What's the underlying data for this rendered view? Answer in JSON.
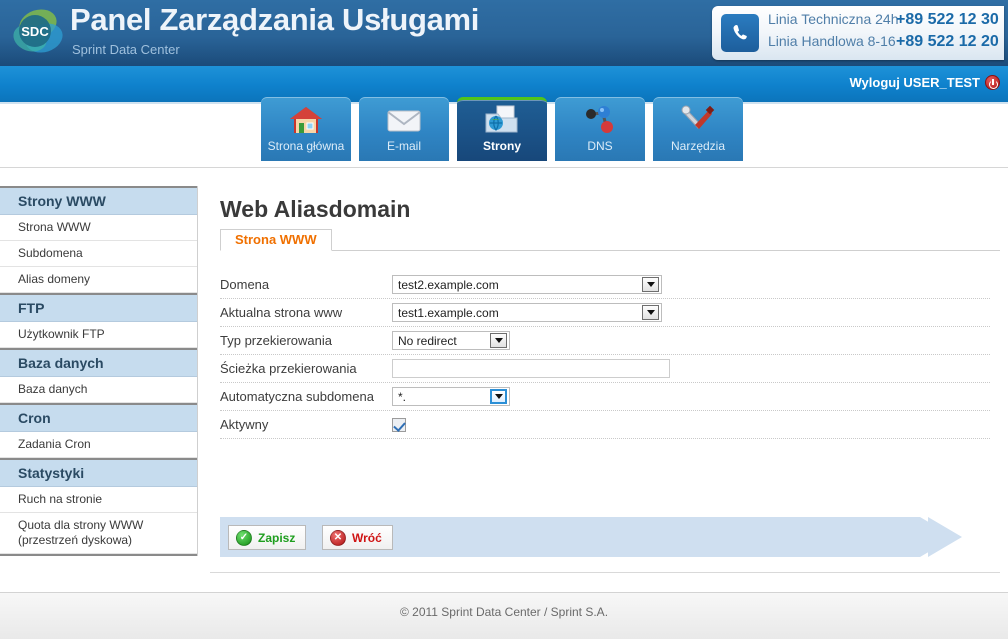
{
  "header": {
    "logo_text": "SDC",
    "title": "Panel Zarządzania Usługami",
    "subtitle": "Sprint Data Center",
    "contact": {
      "rows": [
        {
          "label": "Linia Techniczna 24h",
          "number": "+89 522 12 30"
        },
        {
          "label": "Linia Handlowa 8-16",
          "number": "+89 522 12 20"
        }
      ],
      "phone_icon": "phone-icon"
    }
  },
  "topbar": {
    "logout_label": "Wyloguj USER_TEST",
    "logout_icon": "power-icon"
  },
  "nav": {
    "tabs": [
      {
        "label": "Strona główna",
        "icon": "house-icon",
        "active": false
      },
      {
        "label": "E-mail",
        "icon": "envelope-icon",
        "active": false
      },
      {
        "label": "Strony",
        "icon": "folder-globe-icon",
        "active": true
      },
      {
        "label": "DNS",
        "icon": "molecule-icon",
        "active": false
      },
      {
        "label": "Narzędzia",
        "icon": "tools-icon",
        "active": false
      }
    ],
    "active_accent": "#52c41a"
  },
  "sidebar": {
    "sections": [
      {
        "title": "Strony WWW",
        "items": [
          "Strona WWW",
          "Subdomena",
          "Alias domeny"
        ]
      },
      {
        "title": "FTP",
        "items": [
          "Użytkownik FTP"
        ]
      },
      {
        "title": "Baza danych",
        "items": [
          "Baza danych"
        ]
      },
      {
        "title": "Cron",
        "items": [
          "Zadania Cron"
        ]
      },
      {
        "title": "Statystyki",
        "items": [
          "Ruch na stronie",
          "Quota dla strony WWW (przestrzeń dyskowa)"
        ]
      }
    ]
  },
  "main": {
    "page_title": "Web Aliasdomain",
    "tab_label": "Strona WWW",
    "fields": {
      "domena": {
        "label": "Domena",
        "value": "test2.example.com"
      },
      "aktualna": {
        "label": "Aktualna strona www",
        "value": "test1.example.com"
      },
      "typ": {
        "label": "Typ przekierowania",
        "value": "No redirect"
      },
      "sciezka": {
        "label": "Ścieżka przekierowania",
        "value": "",
        "placeholder": ""
      },
      "subdomena": {
        "label": "Automatyczna subdomena",
        "value": "*."
      },
      "aktywny": {
        "label": "Aktywny",
        "checked": true
      }
    }
  },
  "actions": {
    "save_label": "Zapisz",
    "save_icon": "check-circle-icon",
    "back_label": "Wróć",
    "back_icon": "cross-circle-icon"
  },
  "footer": {
    "copyright": "© 2011 Sprint Data Center / Sprint S.A."
  }
}
